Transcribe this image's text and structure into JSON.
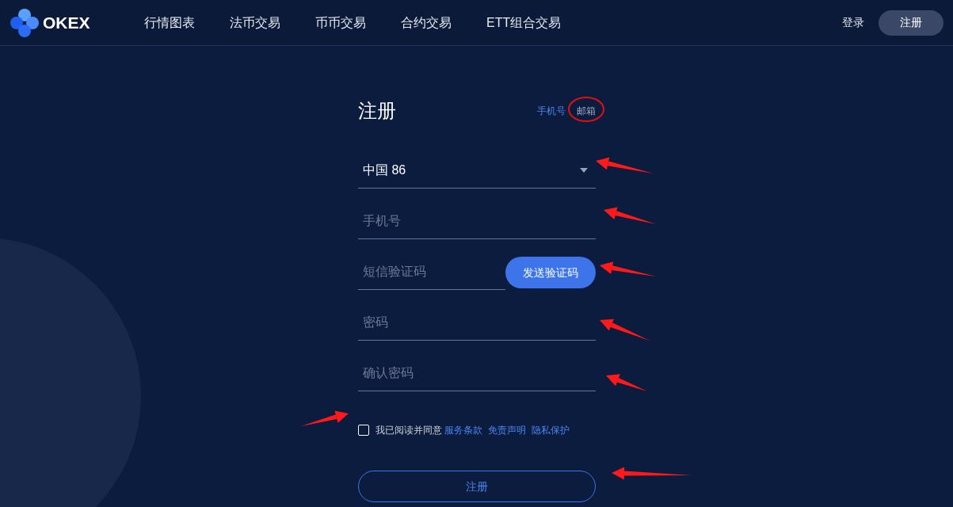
{
  "header": {
    "logo": "OKEX",
    "nav": [
      {
        "label": "行情图表"
      },
      {
        "label": "法币交易"
      },
      {
        "label": "币币交易"
      },
      {
        "label": "合约交易"
      },
      {
        "label": "ETT组合交易"
      }
    ],
    "login": "登录",
    "register": "注册"
  },
  "form": {
    "title": "注册",
    "tabs": [
      {
        "label": "手机号",
        "selected": true
      },
      {
        "label": "邮箱",
        "selected": false
      }
    ],
    "country": "中国 86",
    "phone": {
      "placeholder": "手机号"
    },
    "sms": {
      "placeholder": "短信验证码"
    },
    "send_code": "发送验证码",
    "password": {
      "placeholder": "密码"
    },
    "confirm": {
      "placeholder": "确认密码"
    },
    "agree": {
      "checked": false,
      "text": "我已阅读并同意",
      "links": [
        "服务条款",
        "免责声明",
        "隐私保护"
      ]
    },
    "submit": "注册"
  }
}
